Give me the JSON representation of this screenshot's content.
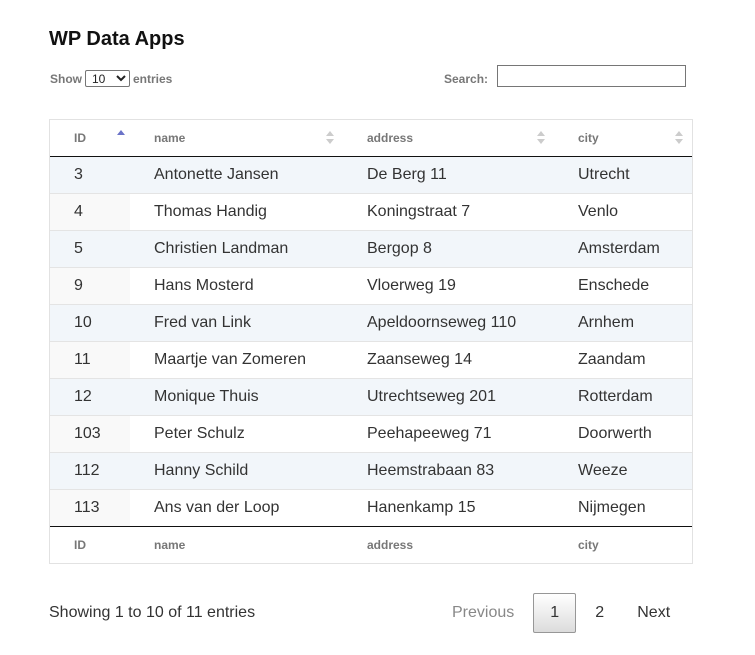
{
  "title": "WP Data Apps",
  "length": {
    "show_label": "Show",
    "entries_label": "entries",
    "selected": "10"
  },
  "search": {
    "label": "Search:",
    "value": ""
  },
  "table": {
    "columns": [
      "ID",
      "name",
      "address",
      "city"
    ],
    "footer_columns": [
      "ID",
      "name",
      "address",
      "city"
    ],
    "rows": [
      [
        "3",
        "Antonette Jansen",
        "De Berg 11",
        "Utrecht"
      ],
      [
        "4",
        "Thomas Handig",
        "Koningstraat 7",
        "Venlo"
      ],
      [
        "5",
        "Christien Landman",
        "Bergop 8",
        "Amsterdam"
      ],
      [
        "9",
        "Hans Mosterd",
        "Vloerweg 19",
        "Enschede"
      ],
      [
        "10",
        "Fred van Link",
        "Apeldoornseweg 110",
        "Arnhem"
      ],
      [
        "11",
        "Maartje van Zomeren",
        "Zaanseweg 14",
        "Zaandam"
      ],
      [
        "12",
        "Monique Thuis",
        "Utrechtseweg 201",
        "Rotterdam"
      ],
      [
        "103",
        "Peter Schulz",
        "Peehapeeweg 71",
        "Doorwerth"
      ],
      [
        "112",
        "Hanny Schild",
        "Heemstrabaan 83",
        "Weeze"
      ],
      [
        "113",
        "Ans van der Loop",
        "Hanenkamp 15",
        "Nijmegen"
      ]
    ],
    "sorted_column": "ID",
    "sort_direction": "ascending"
  },
  "info": "Showing 1 to 10 of 11 entries",
  "pager": {
    "previous": "Previous",
    "pages": [
      "1",
      "2"
    ],
    "current": "1",
    "next": "Next"
  },
  "colors": {
    "odd_row": "#f2f6fa",
    "sort_active": "#6b73c8"
  }
}
